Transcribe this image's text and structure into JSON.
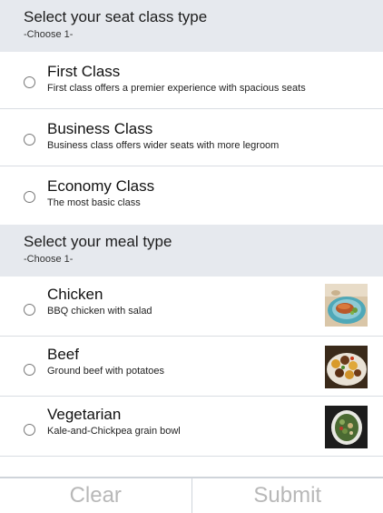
{
  "seat_section": {
    "title": "Select your seat class type",
    "hint": "-Choose 1-",
    "options": [
      {
        "label": "First Class",
        "desc": "First class offers a premier experience with spacious seats"
      },
      {
        "label": "Business Class",
        "desc": "Business class offers wider seats with more legroom"
      },
      {
        "label": "Economy Class",
        "desc": "The most basic class"
      }
    ]
  },
  "meal_section": {
    "title": "Select your meal type",
    "hint": "-Choose 1-",
    "options": [
      {
        "label": "Chicken",
        "desc": "BBQ chicken with salad",
        "image": "chicken-salad-plate-image"
      },
      {
        "label": "Beef",
        "desc": "Ground beef with potatoes",
        "image": "beef-potatoes-dish-image"
      },
      {
        "label": "Vegetarian",
        "desc": "Kale-and-Chickpea grain bowl",
        "image": "kale-chickpea-bowl-image"
      }
    ]
  },
  "footer": {
    "clear_label": "Clear",
    "submit_label": "Submit"
  },
  "colors": {
    "section_bg": "#e6e9ee",
    "divider": "#d9dde2",
    "button_text_disabled": "#b8b8b8"
  }
}
